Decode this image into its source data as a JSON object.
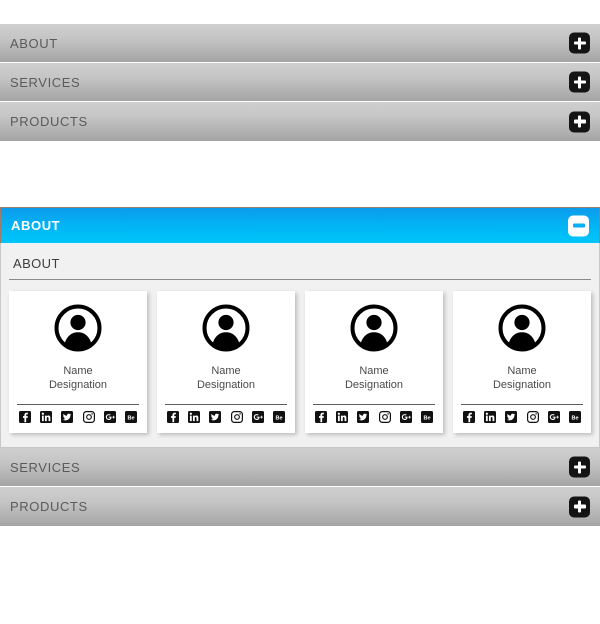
{
  "theme": {
    "accent_blue": "#00b6f5",
    "bar_gray_top": "#cfcfcf",
    "bar_gray_bottom": "#a4a4a4",
    "panel_bg": "#f1f1f1",
    "card_bg": "#ffffff",
    "text_gray": "#5b5b5b"
  },
  "accordion_top": {
    "items": [
      {
        "label": "ABOUT",
        "toggle_icon": "plus-icon",
        "state": "collapsed"
      },
      {
        "label": "SERVICES",
        "toggle_icon": "plus-icon",
        "state": "collapsed"
      },
      {
        "label": "PRODUCTS",
        "toggle_icon": "plus-icon",
        "state": "collapsed"
      }
    ]
  },
  "accordion_bottom": {
    "open_item": {
      "label": "ABOUT",
      "toggle_icon": "minus-icon",
      "state": "expanded",
      "panel": {
        "heading": "ABOUT",
        "cards": [
          {
            "avatar_icon": "user-avatar-icon",
            "name": "Name",
            "designation": "Designation",
            "socials": [
              {
                "icon": "facebook-icon",
                "label": "Facebook"
              },
              {
                "icon": "linkedin-icon",
                "label": "LinkedIn"
              },
              {
                "icon": "twitter-icon",
                "label": "Twitter"
              },
              {
                "icon": "instagram-icon",
                "label": "Instagram"
              },
              {
                "icon": "google-plus-icon",
                "label": "Google Plus"
              },
              {
                "icon": "behance-icon",
                "label": "Behance"
              }
            ]
          },
          {
            "avatar_icon": "user-avatar-icon",
            "name": "Name",
            "designation": "Designation",
            "socials": [
              {
                "icon": "facebook-icon",
                "label": "Facebook"
              },
              {
                "icon": "linkedin-icon",
                "label": "LinkedIn"
              },
              {
                "icon": "twitter-icon",
                "label": "Twitter"
              },
              {
                "icon": "instagram-icon",
                "label": "Instagram"
              },
              {
                "icon": "google-plus-icon",
                "label": "Google Plus"
              },
              {
                "icon": "behance-icon",
                "label": "Behance"
              }
            ]
          },
          {
            "avatar_icon": "user-avatar-icon",
            "name": "Name",
            "designation": "Designation",
            "socials": [
              {
                "icon": "facebook-icon",
                "label": "Facebook"
              },
              {
                "icon": "linkedin-icon",
                "label": "LinkedIn"
              },
              {
                "icon": "twitter-icon",
                "label": "Twitter"
              },
              {
                "icon": "instagram-icon",
                "label": "Instagram"
              },
              {
                "icon": "google-plus-icon",
                "label": "Google Plus"
              },
              {
                "icon": "behance-icon",
                "label": "Behance"
              }
            ]
          },
          {
            "avatar_icon": "user-avatar-icon",
            "name": "Name",
            "designation": "Designation",
            "socials": [
              {
                "icon": "facebook-icon",
                "label": "Facebook"
              },
              {
                "icon": "linkedin-icon",
                "label": "LinkedIn"
              },
              {
                "icon": "twitter-icon",
                "label": "Twitter"
              },
              {
                "icon": "instagram-icon",
                "label": "Instagram"
              },
              {
                "icon": "google-plus-icon",
                "label": "Google Plus"
              },
              {
                "icon": "behance-icon",
                "label": "Behance"
              }
            ]
          }
        ]
      }
    },
    "collapsed_items": [
      {
        "label": "SERVICES",
        "toggle_icon": "plus-icon",
        "state": "collapsed"
      },
      {
        "label": "PRODUCTS",
        "toggle_icon": "plus-icon",
        "state": "collapsed"
      }
    ]
  }
}
